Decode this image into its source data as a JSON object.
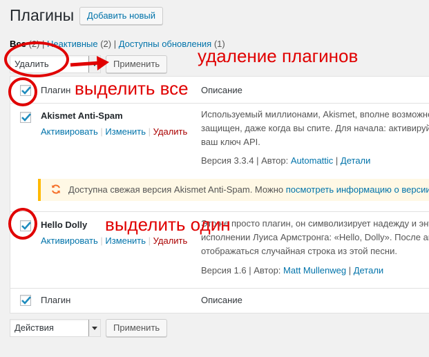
{
  "header": {
    "title": "Плагины",
    "add_new": "Добавить новый"
  },
  "filters": {
    "all_label": "Все",
    "all_count": "(2)",
    "inactive_label": "Неактивные",
    "inactive_count": "(2)",
    "updates_label": "Доступны обновления",
    "updates_count": "(1)",
    "sep": "|"
  },
  "bulk_top": {
    "selected": "Удалить",
    "apply": "Применить"
  },
  "bulk_bottom": {
    "selected": "Действия",
    "apply": "Применить"
  },
  "table": {
    "col_plugin": "Плагин",
    "col_description": "Описание",
    "plugins": [
      {
        "name": "Akismet Anti-Spam",
        "activate": "Активировать",
        "edit": "Изменить",
        "delete": "Удалить",
        "desc_lines": [
          "Используемый миллионами, Akismet, вполне возможно",
          "защищен, даже когда вы спите. Для начала: активируйт",
          "ваш ключ API."
        ],
        "version": "Версия 3.3.4",
        "author_prefix": "Автор:",
        "author": "Automattic",
        "details": "Детали",
        "update_text": "Доступна свежая версия Akismet Anti-Spam. Можно",
        "update_link": "посмотреть информацию о версии"
      },
      {
        "name": "Hello Dolly",
        "activate": "Активировать",
        "edit": "Изменить",
        "delete": "Удалить",
        "desc_lines": [
          "Это не просто плагин, он символизирует надежду и энт",
          "исполнении Луиса Армстронга: «Hello, Dolly». После ак",
          "отображаться случайная строка из этой песни."
        ],
        "version": "Версия 1.6",
        "author_prefix": "Автор:",
        "author": "Matt Mullenweg",
        "details": "Детали"
      }
    ]
  },
  "annotations": {
    "delete_plugins": "удаление плагинов",
    "select_all": "выделить все",
    "select_one": "выделить один"
  },
  "colors": {
    "annotation_red": "#e00000",
    "link_blue": "#0073aa",
    "checkbox_blue": "#1e8cbe",
    "delete_red": "#aa0000"
  }
}
